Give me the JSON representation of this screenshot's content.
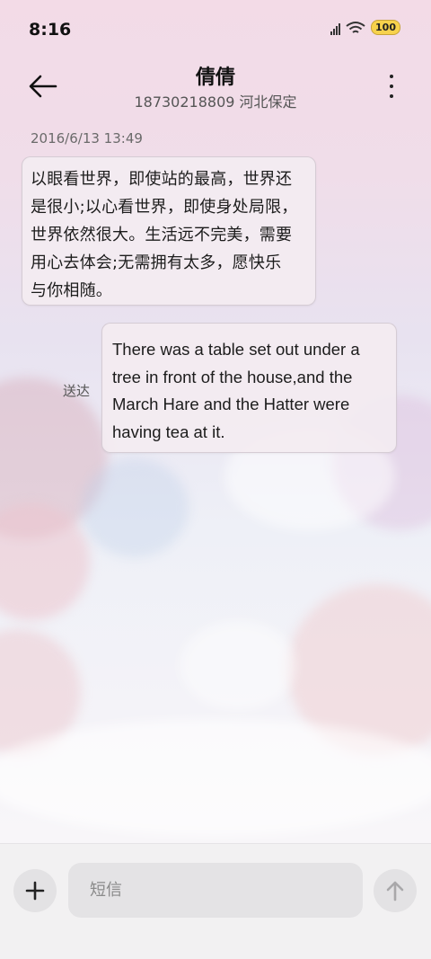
{
  "status_bar": {
    "time": "8:16",
    "battery": "100",
    "icons": [
      "signal-icon",
      "wifi-icon",
      "battery-icon"
    ]
  },
  "header": {
    "contact_name": "倩倩",
    "contact_detail": "18730218809 河北保定",
    "back_icon": "arrow-left-icon",
    "more_icon": "more-vertical-icon"
  },
  "conversation": {
    "timestamp": "2016/6/13 13:49",
    "messages": [
      {
        "direction": "incoming",
        "lines": [
          "以眼看世界，即使站的最高，世界还",
          "是很小;以心看世界，即使身处局限，",
          "世界依然很大。生活远不完美，需要",
          "用心去体会;无需拥有太多，愿快乐",
          "与你相随。"
        ]
      },
      {
        "direction": "outgoing",
        "status": "送达",
        "lines": [
          "There was a table set out under a",
          "tree in front of the house,and the",
          "March Hare and the Hatter were",
          "having tea at it."
        ]
      }
    ]
  },
  "composer": {
    "add_icon": "plus-icon",
    "placeholder": "短信",
    "send_icon": "arrow-up-icon"
  },
  "colors": {
    "background_top": "#f3dbe7",
    "bubble": "#f3ebf1",
    "input_bar": "#f2f1f2"
  }
}
